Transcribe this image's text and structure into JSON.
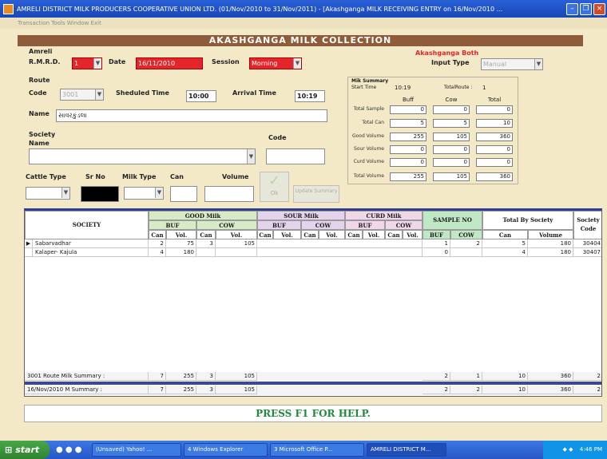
{
  "window": {
    "title": "AMRELI DISTRICT MILK PRODUCERS COOPERATIVE UNION LTD. (01/Nov/2010 to 31/Nov/2011) - [Akashganga MILK RECEIVING ENTRY on 16/Nov/2010 ...",
    "menu": "Transaction  Tools  Window  Exit"
  },
  "form": {
    "header": "AKASHGANGA  MILK COLLECTION",
    "amreli_label": "Amreli",
    "rmrd_label": "R.M.R.D.",
    "rmrd_value": "1",
    "date_label": "Date",
    "date_value": "16/11/2010",
    "session_label": "Session",
    "session_value": "Morning",
    "akashganga_both": "Akashganga Both",
    "input_type_label": "Input Type",
    "input_type_value": "Manual",
    "route_label": "Route",
    "code_label": "Code",
    "code_value": "3001",
    "sheduled_label": "Sheduled Time",
    "sheduled_value": "10:00",
    "arrival_label": "Arrival Time",
    "arrival_value": "10:19",
    "name_label": "Name",
    "name_value": "સાવરકુંડલા",
    "society_label": "Society",
    "society_name_label": "Name",
    "society_code_label": "Code",
    "cattle_type_label": "Cattle Type",
    "srno_label": "Sr No",
    "milk_type_label": "Milk Type",
    "can_label": "Can",
    "volume_label": "Volume",
    "ok_label": "Ok",
    "update_label": "Update Summary"
  },
  "summary": {
    "title": "Mik Summary",
    "start_time_label": "Start Time",
    "start_time_value": "10:19",
    "total_route_label": "TotalRoute :",
    "total_route_value": "1",
    "cols": [
      "Buff",
      "Cow",
      "Total"
    ],
    "rows": [
      {
        "label": "Total Sample",
        "values": [
          "0",
          "0",
          "0"
        ]
      },
      {
        "label": "Total Can",
        "values": [
          "5",
          "5",
          "10"
        ]
      },
      {
        "label": "Good Volume",
        "values": [
          "255",
          "105",
          "360"
        ]
      },
      {
        "label": "Sour Volume",
        "values": [
          "0",
          "0",
          "0"
        ]
      },
      {
        "label": "Curd Volume",
        "values": [
          "0",
          "0",
          "0"
        ]
      },
      {
        "label": "Total Volume",
        "values": [
          "255",
          "105",
          "360"
        ]
      }
    ]
  },
  "grid": {
    "society_header": "SOCIETY",
    "good_milk": "GOOD Milk",
    "sour_milk": "SOUR Milk",
    "curd_milk": "CURD Milk",
    "sample_no": "SAMPLE NO",
    "total_by_society": "Total By Society",
    "society_code": "Society Code",
    "buff": "BUF",
    "cow": "COW",
    "can": "Can",
    "vol": "Vol.",
    "volume": "Volume",
    "rows": [
      {
        "society": "Sabarvadhar",
        "gb_can": "2",
        "gb_vol": "75",
        "gc_can": "3",
        "gc_vol": "105",
        "s_buf": "1",
        "s_cow": "2",
        "t_can": "5",
        "t_vol": "180",
        "code": "30404"
      },
      {
        "society": "Kalaper- Kajula",
        "gb_can": "4",
        "gb_vol": "180",
        "gc_can": "",
        "gc_vol": "",
        "s_buf": "0",
        "s_cow": "",
        "t_can": "4",
        "t_vol": "180",
        "code": "30407"
      }
    ],
    "summary_rows": [
      {
        "label": "3001 Route Milk Summary :",
        "gb_can": "7",
        "gb_vol": "255",
        "gc_can": "3",
        "gc_vol": "105",
        "s_buf": "2",
        "s_cow": "1",
        "t_can": "10",
        "t_vol": "360",
        "code": "2"
      },
      {
        "label": "16/Nov/2010  M  Summary :",
        "gb_can": "7",
        "gb_vol": "255",
        "gc_can": "3",
        "gc_vol": "105",
        "s_buf": "2",
        "s_cow": "2",
        "t_can": "10",
        "t_vol": "360",
        "code": "2"
      }
    ]
  },
  "help": "PRESS F1 FOR HELP.",
  "taskbar": {
    "start": "start",
    "items": [
      "(Unsaved) Yahoo! ...",
      "4 Windows Explorer",
      "3 Microsoft Office P...",
      "AMRELI DISTRICT M..."
    ],
    "clock": "4:46 PM"
  }
}
